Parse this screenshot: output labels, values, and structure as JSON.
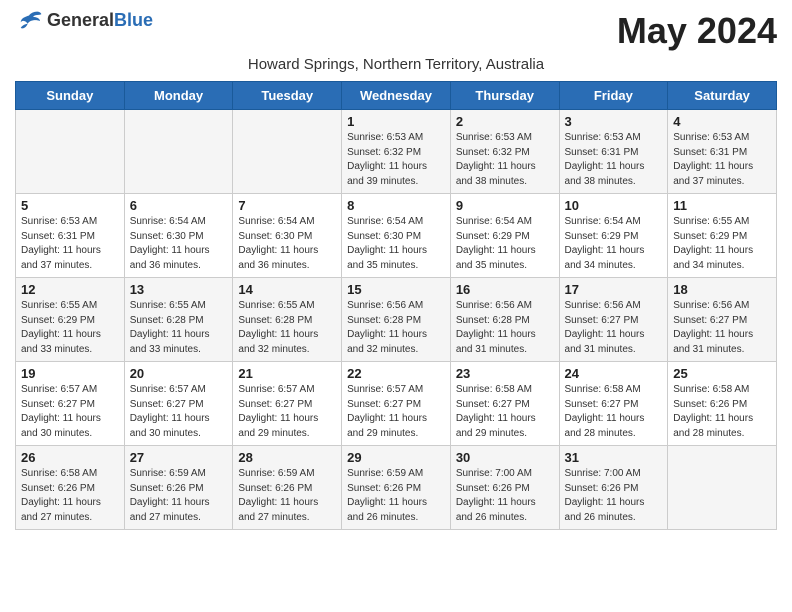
{
  "header": {
    "logo_general": "General",
    "logo_blue": "Blue",
    "month_title": "May 2024",
    "subtitle": "Howard Springs, Northern Territory, Australia"
  },
  "days_of_week": [
    "Sunday",
    "Monday",
    "Tuesday",
    "Wednesday",
    "Thursday",
    "Friday",
    "Saturday"
  ],
  "weeks": [
    [
      {
        "day": "",
        "sunrise": "",
        "sunset": "",
        "daylight": ""
      },
      {
        "day": "",
        "sunrise": "",
        "sunset": "",
        "daylight": ""
      },
      {
        "day": "",
        "sunrise": "",
        "sunset": "",
        "daylight": ""
      },
      {
        "day": "1",
        "sunrise": "Sunrise: 6:53 AM",
        "sunset": "Sunset: 6:32 PM",
        "daylight": "Daylight: 11 hours and 39 minutes."
      },
      {
        "day": "2",
        "sunrise": "Sunrise: 6:53 AM",
        "sunset": "Sunset: 6:32 PM",
        "daylight": "Daylight: 11 hours and 38 minutes."
      },
      {
        "day": "3",
        "sunrise": "Sunrise: 6:53 AM",
        "sunset": "Sunset: 6:31 PM",
        "daylight": "Daylight: 11 hours and 38 minutes."
      },
      {
        "day": "4",
        "sunrise": "Sunrise: 6:53 AM",
        "sunset": "Sunset: 6:31 PM",
        "daylight": "Daylight: 11 hours and 37 minutes."
      }
    ],
    [
      {
        "day": "5",
        "sunrise": "Sunrise: 6:53 AM",
        "sunset": "Sunset: 6:31 PM",
        "daylight": "Daylight: 11 hours and 37 minutes."
      },
      {
        "day": "6",
        "sunrise": "Sunrise: 6:54 AM",
        "sunset": "Sunset: 6:30 PM",
        "daylight": "Daylight: 11 hours and 36 minutes."
      },
      {
        "day": "7",
        "sunrise": "Sunrise: 6:54 AM",
        "sunset": "Sunset: 6:30 PM",
        "daylight": "Daylight: 11 hours and 36 minutes."
      },
      {
        "day": "8",
        "sunrise": "Sunrise: 6:54 AM",
        "sunset": "Sunset: 6:30 PM",
        "daylight": "Daylight: 11 hours and 35 minutes."
      },
      {
        "day": "9",
        "sunrise": "Sunrise: 6:54 AM",
        "sunset": "Sunset: 6:29 PM",
        "daylight": "Daylight: 11 hours and 35 minutes."
      },
      {
        "day": "10",
        "sunrise": "Sunrise: 6:54 AM",
        "sunset": "Sunset: 6:29 PM",
        "daylight": "Daylight: 11 hours and 34 minutes."
      },
      {
        "day": "11",
        "sunrise": "Sunrise: 6:55 AM",
        "sunset": "Sunset: 6:29 PM",
        "daylight": "Daylight: 11 hours and 34 minutes."
      }
    ],
    [
      {
        "day": "12",
        "sunrise": "Sunrise: 6:55 AM",
        "sunset": "Sunset: 6:29 PM",
        "daylight": "Daylight: 11 hours and 33 minutes."
      },
      {
        "day": "13",
        "sunrise": "Sunrise: 6:55 AM",
        "sunset": "Sunset: 6:28 PM",
        "daylight": "Daylight: 11 hours and 33 minutes."
      },
      {
        "day": "14",
        "sunrise": "Sunrise: 6:55 AM",
        "sunset": "Sunset: 6:28 PM",
        "daylight": "Daylight: 11 hours and 32 minutes."
      },
      {
        "day": "15",
        "sunrise": "Sunrise: 6:56 AM",
        "sunset": "Sunset: 6:28 PM",
        "daylight": "Daylight: 11 hours and 32 minutes."
      },
      {
        "day": "16",
        "sunrise": "Sunrise: 6:56 AM",
        "sunset": "Sunset: 6:28 PM",
        "daylight": "Daylight: 11 hours and 31 minutes."
      },
      {
        "day": "17",
        "sunrise": "Sunrise: 6:56 AM",
        "sunset": "Sunset: 6:27 PM",
        "daylight": "Daylight: 11 hours and 31 minutes."
      },
      {
        "day": "18",
        "sunrise": "Sunrise: 6:56 AM",
        "sunset": "Sunset: 6:27 PM",
        "daylight": "Daylight: 11 hours and 31 minutes."
      }
    ],
    [
      {
        "day": "19",
        "sunrise": "Sunrise: 6:57 AM",
        "sunset": "Sunset: 6:27 PM",
        "daylight": "Daylight: 11 hours and 30 minutes."
      },
      {
        "day": "20",
        "sunrise": "Sunrise: 6:57 AM",
        "sunset": "Sunset: 6:27 PM",
        "daylight": "Daylight: 11 hours and 30 minutes."
      },
      {
        "day": "21",
        "sunrise": "Sunrise: 6:57 AM",
        "sunset": "Sunset: 6:27 PM",
        "daylight": "Daylight: 11 hours and 29 minutes."
      },
      {
        "day": "22",
        "sunrise": "Sunrise: 6:57 AM",
        "sunset": "Sunset: 6:27 PM",
        "daylight": "Daylight: 11 hours and 29 minutes."
      },
      {
        "day": "23",
        "sunrise": "Sunrise: 6:58 AM",
        "sunset": "Sunset: 6:27 PM",
        "daylight": "Daylight: 11 hours and 29 minutes."
      },
      {
        "day": "24",
        "sunrise": "Sunrise: 6:58 AM",
        "sunset": "Sunset: 6:27 PM",
        "daylight": "Daylight: 11 hours and 28 minutes."
      },
      {
        "day": "25",
        "sunrise": "Sunrise: 6:58 AM",
        "sunset": "Sunset: 6:26 PM",
        "daylight": "Daylight: 11 hours and 28 minutes."
      }
    ],
    [
      {
        "day": "26",
        "sunrise": "Sunrise: 6:58 AM",
        "sunset": "Sunset: 6:26 PM",
        "daylight": "Daylight: 11 hours and 27 minutes."
      },
      {
        "day": "27",
        "sunrise": "Sunrise: 6:59 AM",
        "sunset": "Sunset: 6:26 PM",
        "daylight": "Daylight: 11 hours and 27 minutes."
      },
      {
        "day": "28",
        "sunrise": "Sunrise: 6:59 AM",
        "sunset": "Sunset: 6:26 PM",
        "daylight": "Daylight: 11 hours and 27 minutes."
      },
      {
        "day": "29",
        "sunrise": "Sunrise: 6:59 AM",
        "sunset": "Sunset: 6:26 PM",
        "daylight": "Daylight: 11 hours and 26 minutes."
      },
      {
        "day": "30",
        "sunrise": "Sunrise: 7:00 AM",
        "sunset": "Sunset: 6:26 PM",
        "daylight": "Daylight: 11 hours and 26 minutes."
      },
      {
        "day": "31",
        "sunrise": "Sunrise: 7:00 AM",
        "sunset": "Sunset: 6:26 PM",
        "daylight": "Daylight: 11 hours and 26 minutes."
      },
      {
        "day": "",
        "sunrise": "",
        "sunset": "",
        "daylight": ""
      }
    ]
  ]
}
